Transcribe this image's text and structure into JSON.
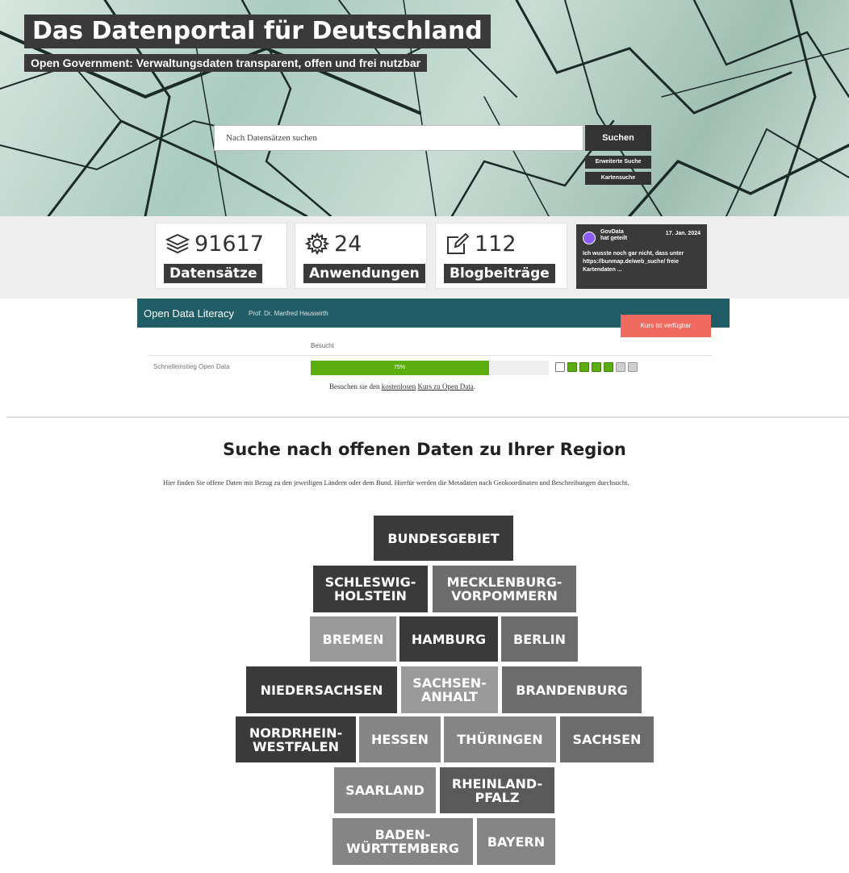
{
  "hero": {
    "title": "Das Datenportal für Deutschland",
    "subtitle": "Open Government: Verwaltungsdaten transparent, offen und frei nutzbar",
    "search_placeholder": "Nach Datensätzen suchen",
    "search_button": "Suchen",
    "advanced_search": "Erweiterte Suche",
    "map_search": "Kartensuche"
  },
  "stats": [
    {
      "value": "91617",
      "label": "Datensätze",
      "icon": "layers-icon"
    },
    {
      "value": "24",
      "label": "Anwendungen",
      "icon": "gear-icon"
    },
    {
      "value": "112",
      "label": "Blogbeiträge",
      "icon": "pencil-icon"
    }
  ],
  "social": {
    "name": "GovData",
    "action": "hat geteilt",
    "date": "17. Jan. 2024",
    "text": "Ich wusste noch gar nicht, dass unter https://bunmap.de/web_suche/ freie Kartendaten ...",
    "avatar_color": "#8a5cf5"
  },
  "course": {
    "title": "Open Data Literacy",
    "author": "Prof. Dr. Manfred Hauswirth",
    "button": "Kurs ist verfügbar",
    "header": "Besucht",
    "item": "Schnelleinstieg Open Data",
    "progress_text": "75%",
    "progress": 0.75,
    "note_prefix": "Besuchen sie den",
    "note_link1": "kostenlosen",
    "note_link2": "Kurs zu Open Data",
    "note_suffix": ".",
    "lessons": [
      "first",
      "done",
      "done",
      "done",
      "done",
      "todo",
      "todo"
    ],
    "colors": {
      "bar": "#215d67",
      "button": "#f06a5f",
      "progress": "#5cad0f"
    }
  },
  "region": {
    "title": "Suche nach offenen Daten zu Ihrer Region",
    "description": "Hier finden Sie offene Daten mit Bezug zu den jeweiligen Ländern oder dem Bund. Hierfür werden die Metadaten nach Geokoordinaten und Beschreibungen durchsucht.",
    "tiles": [
      {
        "id": "bundesgebiet",
        "label": "BUNDESGEBIET",
        "color": "#3a3a3a"
      },
      {
        "id": "schleswig-holstein",
        "label": "SCHLESWIG-\nHOLSTEIN",
        "color": "#3a3a3a"
      },
      {
        "id": "mecklenburg-vorpommern",
        "label": "MECKLENBURG-\nVORPOMMERN",
        "color": "#6c6c6c"
      },
      {
        "id": "bremen",
        "label": "BREMEN",
        "color": "#9a9a9a"
      },
      {
        "id": "hamburg",
        "label": "HAMBURG",
        "color": "#3a3a3a"
      },
      {
        "id": "berlin",
        "label": "BERLIN",
        "color": "#6c6c6c"
      },
      {
        "id": "niedersachsen",
        "label": "NIEDERSACHSEN",
        "color": "#3a3a3a"
      },
      {
        "id": "sachsen-anhalt",
        "label": "SACHSEN-\nANHALT",
        "color": "#9a9a9a"
      },
      {
        "id": "brandenburg",
        "label": "BRANDENBURG",
        "color": "#6c6c6c"
      },
      {
        "id": "nordrhein-westfalen",
        "label": "NORDRHEIN-\nWESTFALEN",
        "color": "#3a3a3a"
      },
      {
        "id": "hessen",
        "label": "HESSEN",
        "color": "#858585"
      },
      {
        "id": "thueringen",
        "label": "THÜRINGEN",
        "color": "#858585"
      },
      {
        "id": "sachsen",
        "label": "SACHSEN",
        "color": "#6c6c6c"
      },
      {
        "id": "saarland",
        "label": "SAARLAND",
        "color": "#858585"
      },
      {
        "id": "rheinland-pfalz",
        "label": "RHEINLAND-\nPFALZ",
        "color": "#5a5a5a"
      },
      {
        "id": "baden-wuerttemberg",
        "label": "BADEN-\nWÜRTTEMBERG",
        "color": "#858585"
      },
      {
        "id": "bayern",
        "label": "BAYERN",
        "color": "#858585"
      }
    ]
  }
}
